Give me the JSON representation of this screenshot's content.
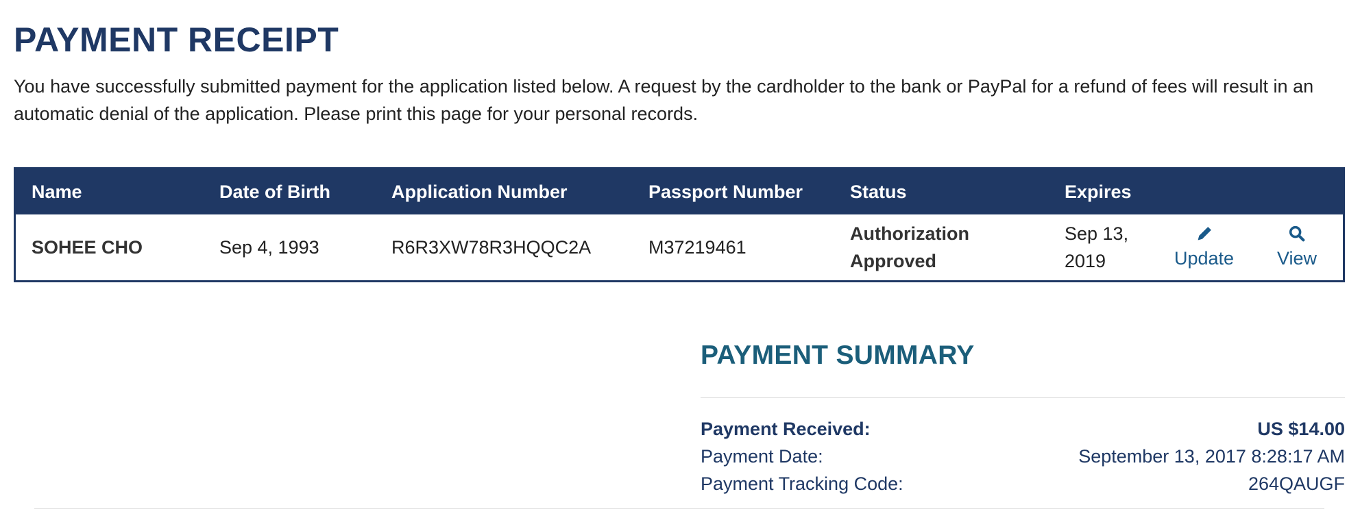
{
  "page": {
    "title": "PAYMENT RECEIPT",
    "intro": "You have successfully submitted payment for the application listed below. A request by the cardholder to the bank or PayPal for a refund of fees will result in an automatic denial of the application. Please print this page for your personal records."
  },
  "colors": {
    "header_bg": "#1f3864",
    "summary_title": "#1b5e7a",
    "link": "#1a5a8a"
  },
  "table": {
    "headers": {
      "name": "Name",
      "dob": "Date of Birth",
      "app_number": "Application Number",
      "passport": "Passport Number",
      "status": "Status",
      "expires": "Expires"
    },
    "row": {
      "name": "SOHEE CHO",
      "dob": "Sep 4, 1993",
      "app_number": "R6R3XW78R3HQQC2A",
      "passport": "M37219461",
      "status": "Authorization Approved",
      "expires": "Sep 13, 2019",
      "update_label": "Update",
      "update_icon": "pencil-icon",
      "view_label": "View",
      "view_icon": "search-icon"
    }
  },
  "summary": {
    "title": "PAYMENT SUMMARY",
    "received_label": "Payment Received:",
    "received_value": "US $14.00",
    "date_label": "Payment Date:",
    "date_value": "September 13, 2017 8:28:17 AM",
    "tracking_label": "Payment Tracking Code:",
    "tracking_value": "264QAUGF"
  }
}
